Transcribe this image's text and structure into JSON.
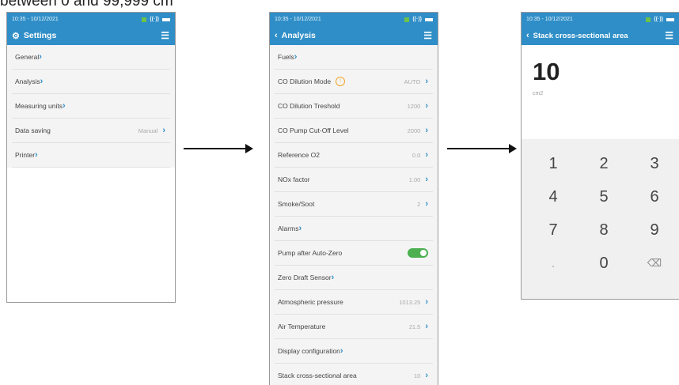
{
  "caption": "between 0 and 99,999 cm",
  "status": {
    "time": "10:35 - 10/12/2021"
  },
  "settings": {
    "title": "Settings",
    "items": [
      {
        "label": "General",
        "value": ""
      },
      {
        "label": "Analysis",
        "value": ""
      },
      {
        "label": "Measuring units",
        "value": ""
      },
      {
        "label": "Data saving",
        "value": "Manual"
      },
      {
        "label": "Printer",
        "value": ""
      }
    ]
  },
  "analysis": {
    "title": "Analysis",
    "items": [
      {
        "label": "Fuels",
        "value": ""
      },
      {
        "label": "CO Dilution Mode",
        "value": "AUTO"
      },
      {
        "label": "CO Dilution Treshold",
        "value": "1200"
      },
      {
        "label": "CO Pump Cut-Off Level",
        "value": "2000"
      },
      {
        "label": "Reference O2",
        "value": "0.0"
      },
      {
        "label": "NOx factor",
        "value": "1.00"
      },
      {
        "label": "Smoke/Soot",
        "value": "2"
      },
      {
        "label": "Alarms",
        "value": ""
      },
      {
        "label": "Pump after Auto-Zero",
        "value": ""
      },
      {
        "label": "Zero Draft Sensor",
        "value": ""
      },
      {
        "label": "Atmospheric pressure",
        "value": "1013.25"
      },
      {
        "label": "Air Temperature",
        "value": "21.5"
      },
      {
        "label": "Display configuration",
        "value": ""
      },
      {
        "label": "Stack cross-sectional area",
        "value": "10"
      }
    ]
  },
  "stack": {
    "title": "Stack cross-sectional area",
    "value": "10",
    "unit": "cm2",
    "keys": [
      "1",
      "2",
      "3",
      "4",
      "5",
      "6",
      "7",
      "8",
      "9",
      ".",
      "0",
      "⌫"
    ]
  },
  "icons": {
    "settings": "gear-icon",
    "back": "back-chevron-icon",
    "menu": "hamburger-menu-icon",
    "badge": "shield-badge-icon",
    "toggle": "toggle-on"
  },
  "colors": {
    "header": "#2f8ec7",
    "toggle": "#4caf50",
    "badge": "#f0a52c"
  }
}
